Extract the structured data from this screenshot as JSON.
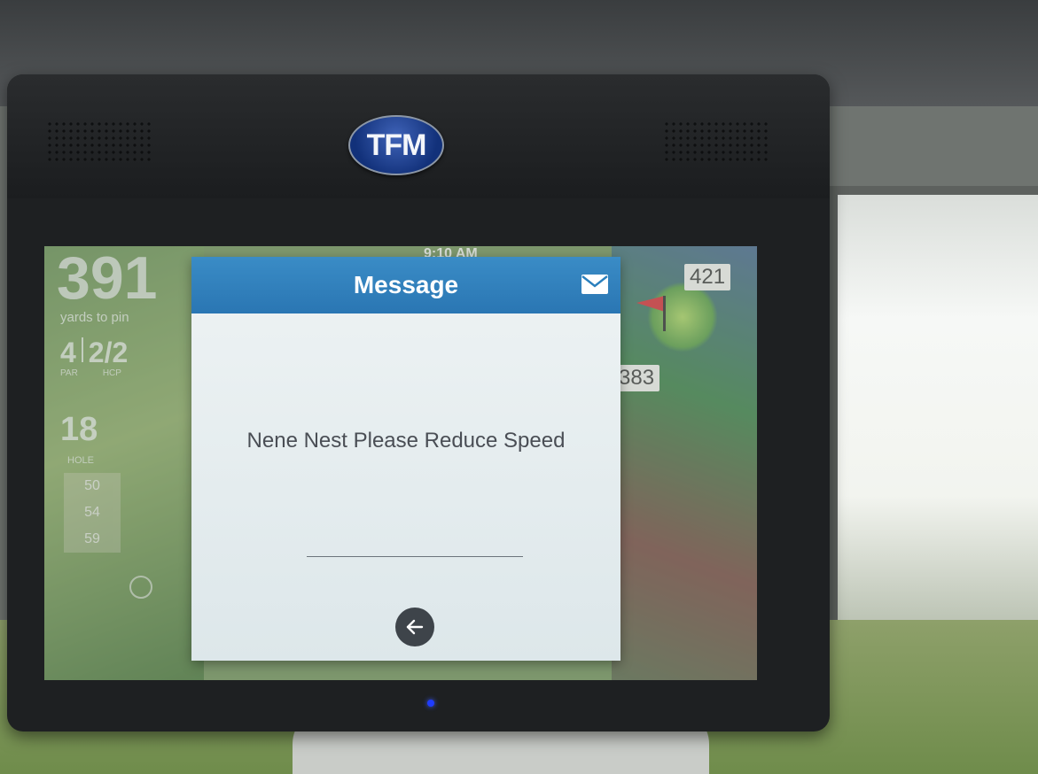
{
  "device": {
    "brand": "TFM"
  },
  "gps": {
    "yards_to_pin": "391",
    "yards_to_pin_label": "yards to pin",
    "par": "4",
    "hdcp": "2/2",
    "par_label": "PAR",
    "hdcp_label": "HCP",
    "hole": "18",
    "hole_label": "HOLE",
    "distances": [
      "50",
      "54",
      "59"
    ],
    "clock": "9:10 AM",
    "tag_far": "421",
    "tag_near": "383"
  },
  "dialog": {
    "title": "Message",
    "message": "Nene Nest Please Reduce Speed",
    "mail_icon": "mail-icon",
    "back_icon": "arrow-left-icon"
  },
  "colors": {
    "header": "#2a7fbd",
    "dialog_bg": "#e6eef0",
    "message_text": "#4a4e55",
    "back_button": "#3e444a",
    "led": "#1f3cff"
  }
}
